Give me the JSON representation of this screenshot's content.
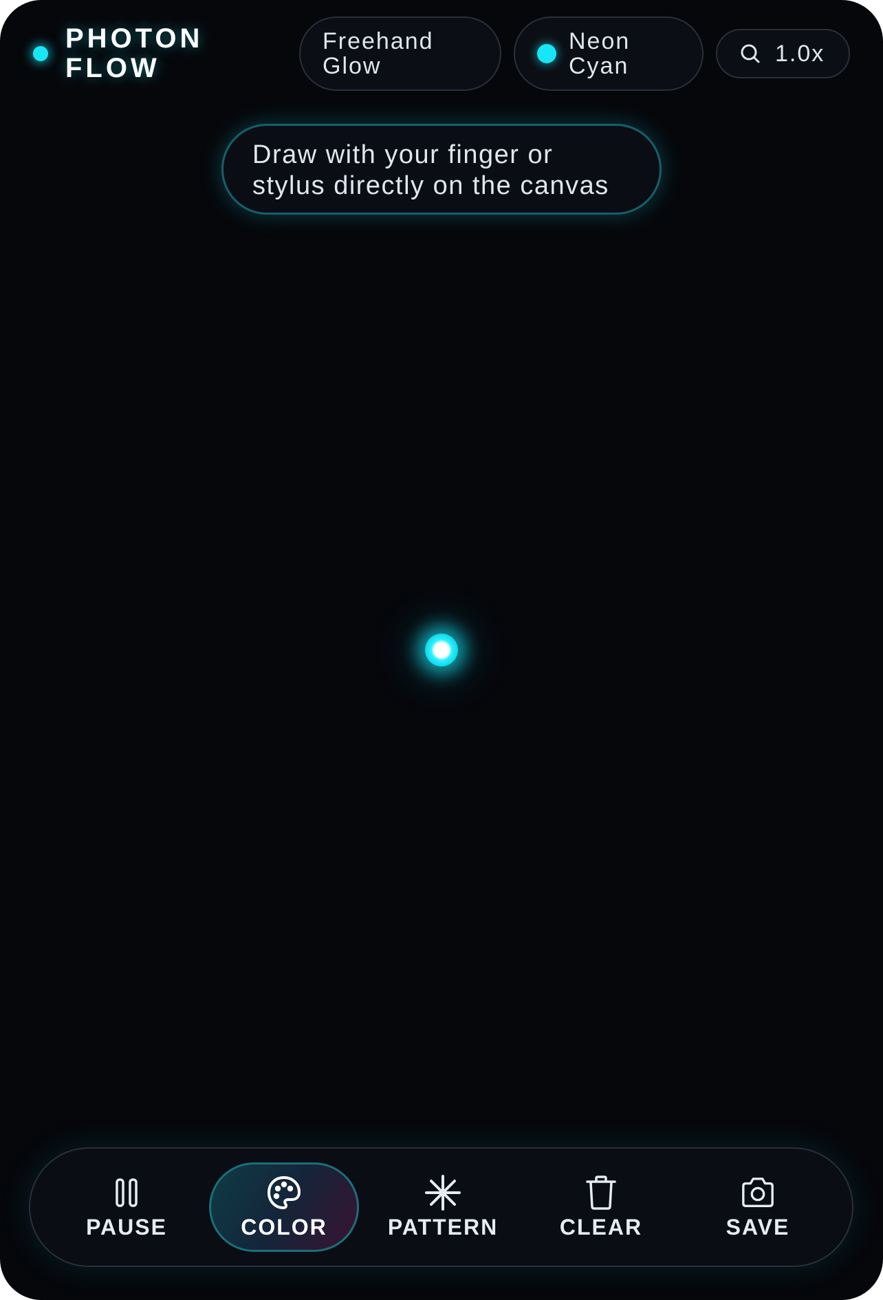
{
  "app": {
    "title": "PHOTON FLOW",
    "accent_color": "#18e6f6"
  },
  "header": {
    "mode": {
      "label": "Freehand Glow"
    },
    "color": {
      "label": "Neon Cyan",
      "swatch": "#18e6f6"
    },
    "zoom": {
      "icon": "search-icon",
      "value": "1.0x"
    }
  },
  "hint": {
    "text": "Draw with your finger or stylus directly on the canvas"
  },
  "toolbar": {
    "active": "COLOR",
    "items": [
      {
        "label": "PAUSE",
        "icon": "pause-icon"
      },
      {
        "label": "COLOR",
        "icon": "palette-icon"
      },
      {
        "label": "PATTERN",
        "icon": "asterisk-icon"
      },
      {
        "label": "CLEAR",
        "icon": "trash-icon"
      },
      {
        "label": "SAVE",
        "icon": "camera-icon"
      }
    ]
  }
}
